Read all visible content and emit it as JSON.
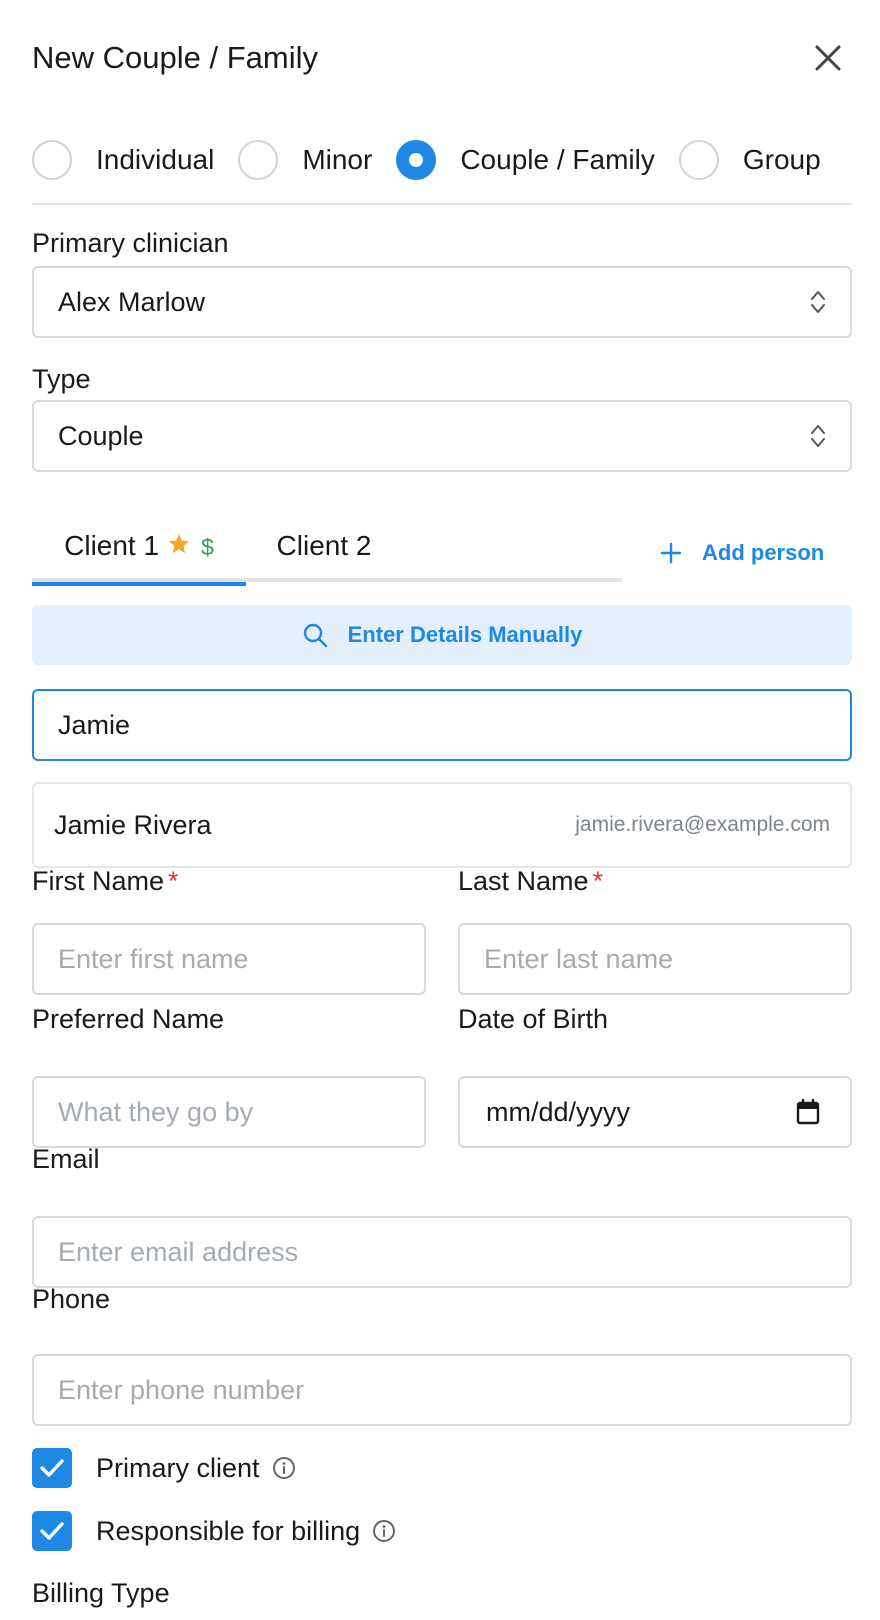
{
  "header": {
    "title": "New Couple / Family"
  },
  "client_kind": {
    "options": [
      {
        "label": "Individual",
        "checked": false
      },
      {
        "label": "Minor",
        "checked": false
      },
      {
        "label": "Couple / Family",
        "checked": true
      },
      {
        "label": "Group",
        "checked": false
      }
    ]
  },
  "primary_clinician": {
    "label": "Primary clinician",
    "value": "Alex Marlow"
  },
  "type": {
    "label": "Type",
    "value": "Couple"
  },
  "tabs": [
    {
      "label": "Client 1",
      "active": true,
      "badges": [
        "star-icon",
        "dollar-icon"
      ],
      "dollar": "$"
    },
    {
      "label": "Client 2",
      "active": false
    }
  ],
  "add_person": {
    "label": "Add person"
  },
  "manual_entry": {
    "label": "Enter Details Manually"
  },
  "client_search": {
    "value": "Jamie"
  },
  "suggestion": {
    "name": "Jamie Rivera",
    "email": "jamie.rivera@example.com"
  },
  "first_name": {
    "label": "First Name",
    "required": "*",
    "placeholder": "Enter first name"
  },
  "last_name": {
    "label": "Last Name",
    "required": "*",
    "placeholder": "Enter last name"
  },
  "preferred_name": {
    "label": "Preferred Name",
    "placeholder": "What they go by"
  },
  "date_of_birth": {
    "label": "Date of Birth",
    "value": "mm/dd/yyyy"
  },
  "email": {
    "label": "Email",
    "placeholder": "Enter email address"
  },
  "phone": {
    "label": "Phone",
    "placeholder": "Enter phone number"
  },
  "checkboxes": [
    {
      "label": "Primary client",
      "checked": true
    },
    {
      "label": "Responsible for billing",
      "checked": true
    }
  ],
  "billing_type": {
    "label": "Billing Type"
  },
  "colors": {
    "accent": "#1e88e5",
    "accent_light": "#e3f0fc",
    "star": "#f5a623",
    "dollar": "#2e9e4f",
    "required": "#e53935"
  }
}
